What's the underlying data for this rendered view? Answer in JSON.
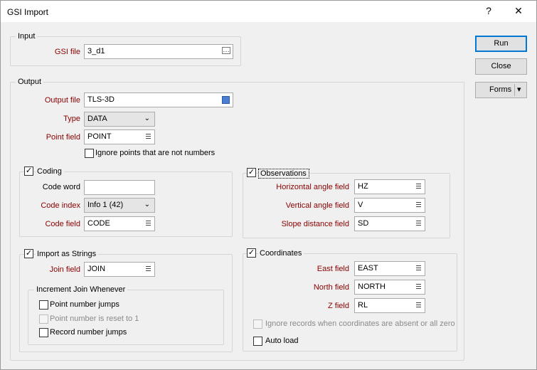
{
  "window": {
    "title": "GSI Import",
    "help_icon": "?",
    "close_icon": "✕"
  },
  "input_group": {
    "label": "Input",
    "gsi_file_label": "GSI file",
    "gsi_file_value": "3_d1",
    "browse_icon": "…"
  },
  "output_group": {
    "label": "Output",
    "output_file_label": "Output file",
    "output_file_value": "TLS-3D",
    "type_label": "Type",
    "type_value": "DATA",
    "point_field_label": "Point field",
    "point_field_value": "POINT",
    "ignore_points_label": "Ignore points that are not numbers",
    "ignore_points_checked": false
  },
  "coding": {
    "label": "Coding",
    "checked": true,
    "code_word_label": "Code word",
    "code_word_value": "",
    "code_index_label": "Code index",
    "code_index_value": "Info 1 (42)",
    "code_field_label": "Code field",
    "code_field_value": "CODE"
  },
  "observations": {
    "label": "Observations",
    "checked": true,
    "horizontal_label": "Horizontal angle field",
    "horizontal_value": "HZ",
    "vertical_label": "Vertical angle field",
    "vertical_value": "V",
    "slope_label": "Slope distance field",
    "slope_value": "SD"
  },
  "strings": {
    "label": "Import as Strings",
    "checked": true,
    "join_field_label": "Join field",
    "join_field_value": "JOIN",
    "increment_label": "Increment Join Whenever",
    "point_number_jumps": "Point number jumps",
    "point_number_reset": "Point number is reset to 1",
    "record_number_jumps": "Record number jumps"
  },
  "coordinates": {
    "label": "Coordinates",
    "checked": true,
    "east_label": "East field",
    "east_value": "EAST",
    "north_label": "North field",
    "north_value": "NORTH",
    "z_label": "Z field",
    "z_value": "RL",
    "ignore_records_label": "Ignore records when coordinates are absent or all zero",
    "auto_load_label": "Auto load"
  },
  "buttons": {
    "run": "Run",
    "close": "Close",
    "forms": "Forms",
    "forms_dropdown": "▾"
  },
  "colors": {
    "required_label": "#8b0000",
    "dialog_bg": "#f0f0f0",
    "default_button_border": "#0078d7"
  }
}
